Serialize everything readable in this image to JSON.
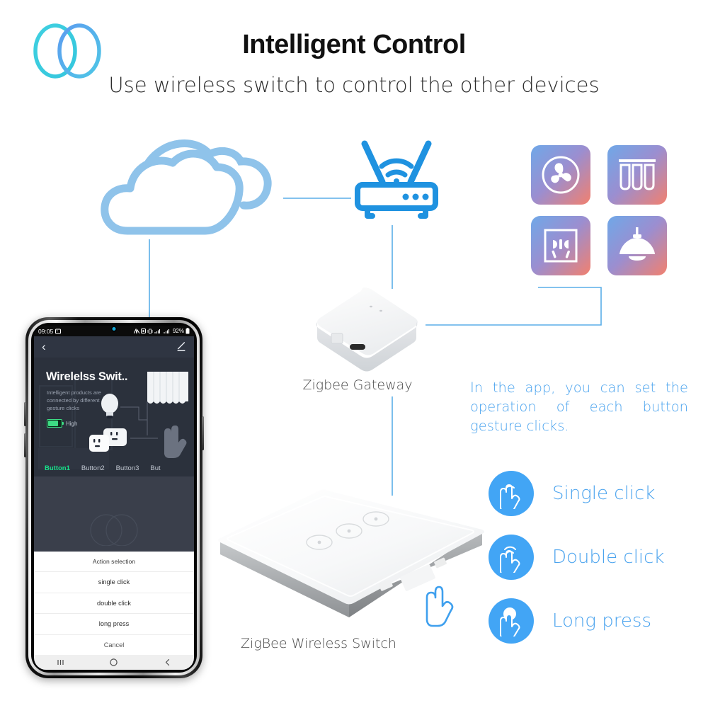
{
  "header": {
    "title": "Intelligent Control",
    "subtitle": "Use wireless switch to control the other devices",
    "logo_name": "interlocking-circles-logo"
  },
  "diagram": {
    "cloud_icon": "cloud-icon",
    "router_icon": "wifi-router-icon",
    "device_tiles": [
      {
        "name": "fan-icon",
        "label": "Fan"
      },
      {
        "name": "curtain-icon",
        "label": "Curtain"
      },
      {
        "name": "socket-icon",
        "label": "Socket"
      },
      {
        "name": "ceiling-lamp-icon",
        "label": "Lamp"
      }
    ],
    "gateway_label": "Zigbee Gateway",
    "switch_label": "ZigBee Wireless Switch",
    "line_color": "#5aaee8",
    "accent_color": "#1f92e0"
  },
  "phone": {
    "status_bar": {
      "time": "09:05",
      "battery_percent": "92%",
      "icons": [
        "photo-icon",
        "network-icon",
        "alarm-icon",
        "vibrate-icon",
        "signal-icon",
        "signal-icon-2",
        "battery-icon"
      ]
    },
    "app_bar": {
      "back_label": "‹",
      "edit_label": "edit-icon"
    },
    "hero": {
      "title": "Wirelelss Swit..",
      "description": "Intelligent products are connected by different gesture clicks",
      "battery_label": "High"
    },
    "tabs": [
      {
        "label": "Button1",
        "active": true
      },
      {
        "label": "Button2",
        "active": false
      },
      {
        "label": "Button3",
        "active": false
      },
      {
        "label": "But",
        "active": false
      }
    ],
    "action_sheet": {
      "header": "Action selection",
      "options": [
        "single click",
        "double click",
        "long press"
      ],
      "cancel": "Cancel"
    },
    "nav_bar": {
      "recents": "recents-icon",
      "home": "home-icon",
      "back": "back-icon"
    },
    "accent_color": "#17e08a",
    "screen_bg": "#2e3440"
  },
  "right_panel": {
    "note": "In the app, you can set the operation of each button gesture clicks.",
    "gestures": [
      {
        "icon": "single-click-hand-icon",
        "label": "Single click"
      },
      {
        "icon": "double-click-hand-icon",
        "label": "Double click"
      },
      {
        "icon": "long-press-hand-icon",
        "label": "Long press"
      }
    ],
    "text_color": "#4aa3ee",
    "badge_color": "#42a5f5"
  }
}
